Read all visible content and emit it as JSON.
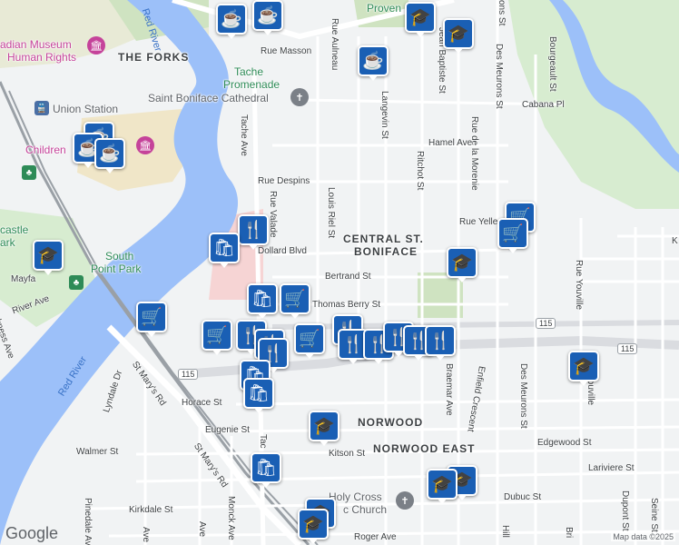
{
  "map": {
    "area_labels": {
      "the_forks": "THE FORKS",
      "central_line1": "CENTRAL ST.",
      "central_line2": "BONIFACE",
      "norwood": "NORWOOD",
      "norwood_east": "NORWOOD EAST"
    },
    "water_labels": {
      "red_river_north": "Red River",
      "red_river_south": "Red River"
    },
    "poi_labels": {
      "museum_line1": "adian Museum",
      "museum_line2": "Human Rights",
      "tache_line1": "Tache",
      "tache_line2": "Promenade",
      "cathedral": "Saint Boniface Cathedral",
      "union_station": "Union Station",
      "children": "Children",
      "south_point_line1": "South",
      "south_point_line2": "Point Park",
      "provencher": "Proven",
      "holy_cross_line1": "Holy Cross",
      "holy_cross_line2": "c Church",
      "castle_line1": "castle",
      "castle_line2": "ark"
    },
    "street_labels": {
      "rue_masson": "Rue Masson",
      "rue_aulneau": "Rue Aulneau",
      "des_meurons_top": "Des Meurons St",
      "des_meurons_bottom": "Des Meurons St",
      "ons_st": "ons St",
      "jean_baptiste": "Jean Baptiste St",
      "bourgeault": "Bourgeault St",
      "cabana": "Cabana Pl",
      "langevin": "Langevin St",
      "rue_de_la_morenie": "Rue de la Morenie",
      "hamel": "Hamel Ave",
      "tache_ave": "Tache Ave",
      "rue_despins": "Rue Despins",
      "ritchot": "Ritchot St",
      "louis_riel": "Louis Riel St",
      "rue_valade": "Rue Valade",
      "rue_yelle": "Rue Yelle",
      "dollard": "Dollard Blvd",
      "bertrand": "Bertrand St",
      "thomas_berry": "Thomas Berry St",
      "rue_youville": "Rue Youville",
      "youville": "Youville",
      "mayfa": "Mayfa",
      "river_ave": "River Ave",
      "kness_ave": "kness Ave",
      "lyndale": "Lyndale Dr",
      "st_marys_1": "St Mary's Rd",
      "st_marys_2": "St Mary's Rd",
      "braemar": "Braemar Ave",
      "enfield": "Enfield Crescent",
      "horace": "Horace St",
      "eugenie": "Eugenie St",
      "kitson": "Kitson St",
      "edgewood": "Edgewood St",
      "walmer": "Walmer St",
      "lariviere": "Lariviere St",
      "dubuc": "Dubuc St",
      "kirkdale": "Kirkdale St",
      "pinedale": "Pinedale Ave",
      "monck": "Monck Ave",
      "tac": "Tac",
      "ave_1": "Ave",
      "ave_2": "Ave",
      "roger": "Roger Ave",
      "hill": "Hill",
      "bri": "Bri",
      "dupont": "Dupont St",
      "seine": "Seine St",
      "k": "K"
    },
    "highway_shields": [
      "115",
      "115",
      "115"
    ],
    "footer": {
      "logo": "Google",
      "attribution": "Map data ©2025"
    },
    "markers": [
      {
        "type": "cafe",
        "icon": "coffee-cup-icon"
      },
      {
        "type": "cafe",
        "icon": "coffee-cup-icon"
      },
      {
        "type": "school",
        "icon": "graduation-cap-icon"
      },
      {
        "type": "school",
        "icon": "graduation-cap-icon"
      },
      {
        "type": "cafe",
        "icon": "coffee-cup-icon"
      },
      {
        "type": "cafe",
        "icon": "coffee-cup-icon"
      },
      {
        "type": "cafe",
        "icon": "coffee-cup-icon"
      },
      {
        "type": "cafe",
        "icon": "coffee-cup-icon"
      },
      {
        "type": "grocery",
        "icon": "shopping-cart-icon"
      },
      {
        "type": "grocery",
        "icon": "shopping-cart-icon"
      },
      {
        "type": "restaurant",
        "icon": "fork-knife-icon"
      },
      {
        "type": "shopping",
        "icon": "shopping-bag-icon"
      },
      {
        "type": "school",
        "icon": "graduation-cap-icon"
      },
      {
        "type": "school",
        "icon": "graduation-cap-icon"
      },
      {
        "type": "shopping",
        "icon": "shopping-bag-icon"
      },
      {
        "type": "grocery",
        "icon": "shopping-cart-icon"
      },
      {
        "type": "grocery",
        "icon": "shopping-cart-icon"
      },
      {
        "type": "grocery",
        "icon": "shopping-cart-icon"
      },
      {
        "type": "restaurant",
        "icon": "fork-knife-icon"
      },
      {
        "type": "restaurant",
        "icon": "fork-knife-icon"
      },
      {
        "type": "grocery",
        "icon": "shopping-cart-icon"
      },
      {
        "type": "restaurant",
        "icon": "fork-knife-icon"
      },
      {
        "type": "restaurant",
        "icon": "fork-knife-icon"
      },
      {
        "type": "restaurant",
        "icon": "fork-knife-icon"
      },
      {
        "type": "restaurant",
        "icon": "fork-knife-icon"
      },
      {
        "type": "restaurant",
        "icon": "fork-knife-icon"
      },
      {
        "type": "restaurant",
        "icon": "fork-knife-icon"
      },
      {
        "type": "restaurant",
        "icon": "fork-knife-icon"
      },
      {
        "type": "school",
        "icon": "graduation-cap-icon"
      },
      {
        "type": "shopping",
        "icon": "shopping-bag-icon"
      },
      {
        "type": "shopping",
        "icon": "shopping-bag-icon"
      },
      {
        "type": "school",
        "icon": "graduation-cap-icon"
      },
      {
        "type": "shopping",
        "icon": "shopping-bag-icon"
      },
      {
        "type": "school",
        "icon": "graduation-cap-icon"
      },
      {
        "type": "school",
        "icon": "graduation-cap-icon"
      },
      {
        "type": "school",
        "icon": "graduation-cap-icon"
      },
      {
        "type": "school",
        "icon": "graduation-cap-icon"
      }
    ],
    "colors": {
      "land": "#f1f3f4",
      "water": "#9cc0f9",
      "park": "#c8e6c9",
      "marker": "#1a5fb4",
      "highway": "#dadce0"
    }
  }
}
